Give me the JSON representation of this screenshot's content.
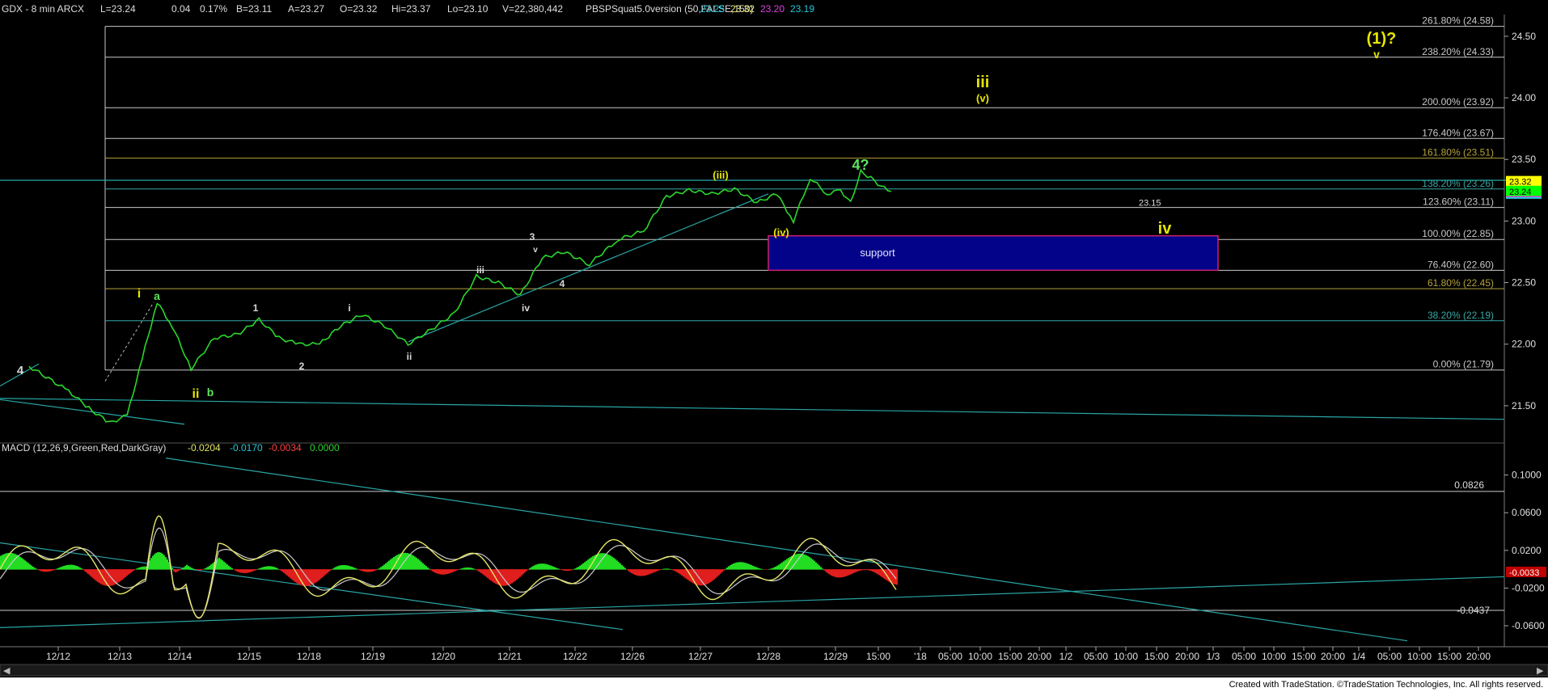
{
  "header": {
    "symbol": "GDX - 8 min  ARCX",
    "last": "L=23.24",
    "change": "0.04",
    "change_pct": "0.17%",
    "bid": "B=23.11",
    "ask": "A=23.27",
    "open": "O=23.32",
    "high": "Hi=23.37",
    "low": "Lo=23.10",
    "volume": "V=22,380,442",
    "indicator": "PBSPSquat5.0version (50,FALSE,150)",
    "ind_values": [
      "23.25",
      "23.32",
      "23.20",
      "23.19"
    ]
  },
  "colors": {
    "background": "#000000",
    "price": "#2bd62b",
    "fib_line": "#c8c8c8",
    "fib_gold": "#b5a23a",
    "fib_teal": "#3aa6a6",
    "trendline": "#2aa6a6",
    "wave_yellow": "#e6e600",
    "wave_green": "#5ee35e",
    "wave_white": "#d8d8d8",
    "support_fill": "#03038a",
    "support_border": "#d0206c",
    "macd_line": "#e6e66a",
    "macd_hist_pos": "#22dd22",
    "macd_hist_neg": "#e01e1e",
    "ind_cyan": "#22c9d9",
    "ind_yellow": "#e6e666",
    "ind_magenta": "#e040e0",
    "ind_cyan2": "#22c9d9"
  },
  "chart_data": [
    {
      "type": "line",
      "ylim": [
        21.25,
        24.65
      ],
      "yticks": [
        "24.50",
        "24.00",
        "23.50",
        "23.00",
        "22.50",
        "22.00",
        "21.50"
      ],
      "x_dates": [
        "12/12",
        "12/13",
        "12/14",
        "12/15",
        "12/18",
        "12/19",
        "12/20",
        "12/21",
        "12/22",
        "12/26",
        "12/27",
        "12/28",
        "12/29",
        "15:00",
        "'18",
        "05:00",
        "10:00",
        "15:00",
        "20:00",
        "1/2",
        "05:00",
        "10:00",
        "15:00",
        "20:00",
        "1/3",
        "05:00",
        "10:00",
        "15:00",
        "20:00",
        "1/4",
        "05:00",
        "10:00",
        "15:00",
        "20:00"
      ],
      "series": [
        {
          "x": [
            "12/11",
            "12/12",
            "12/12",
            "12/12",
            "12/13",
            "12/13",
            "12/13",
            "12/13",
            "12/14",
            "12/14",
            "12/14",
            "12/15",
            "12/15",
            "12/15",
            "12/18",
            "12/18",
            "12/18",
            "12/19",
            "12/19",
            "12/19",
            "12/20",
            "12/20",
            "12/20",
            "12/21",
            "12/21",
            "12/21",
            "12/22",
            "12/22",
            "12/26",
            "12/26",
            "12/26",
            "12/27",
            "12/27",
            "12/27",
            "12/28",
            "12/28",
            "12/28",
            "12/28",
            "12/29",
            "12/29",
            "12/29",
            "12/29",
            "12/29",
            "12/29"
          ],
          "values": [
            21.82,
            21.62,
            21.48,
            21.36,
            21.42,
            21.88,
            22.34,
            22.15,
            21.8,
            22.05,
            22.08,
            22.2,
            22.05,
            22.0,
            22.0,
            22.15,
            22.24,
            22.15,
            22.0,
            22.12,
            22.25,
            22.55,
            22.5,
            22.4,
            22.7,
            22.75,
            22.65,
            22.85,
            22.92,
            23.2,
            23.25,
            23.22,
            23.26,
            23.15,
            23.22,
            23.0,
            23.35,
            23.22,
            23.25,
            23.15,
            23.4,
            23.35,
            23.28,
            23.24
          ]
        }
      ],
      "fib_levels": [
        {
          "label": "261.80% (24.58)",
          "value": 24.58
        },
        {
          "label": "238.20% (24.33)",
          "value": 24.33
        },
        {
          "label": "200.00% (23.92)",
          "value": 23.92
        },
        {
          "label": "176.40% (23.67)",
          "value": 23.67
        },
        {
          "label": "161.80% (23.51)",
          "value": 23.51
        },
        {
          "label": "138.20% (23.26)",
          "value": 23.26
        },
        {
          "label": "123.60% (23.11)",
          "value": 23.11
        },
        {
          "label": "100.00% (22.85)",
          "value": 22.85
        },
        {
          "label": "76.40% (22.60)",
          "value": 22.6
        },
        {
          "label": "61.80% (22.45)",
          "value": 22.45
        },
        {
          "label": "38.20% (22.19)",
          "value": 22.19
        },
        {
          "label": "0.00% (21.79)",
          "value": 21.79
        }
      ],
      "axis_markers": [
        {
          "label": "23.32",
          "value": 23.32
        },
        {
          "label": "23.24",
          "value": 23.24
        },
        {
          "label": "23.15",
          "value": 23.15
        }
      ],
      "support_label": "support",
      "support_range": [
        22.6,
        22.88
      ],
      "wave_labels": [
        "4",
        "i",
        "a",
        "ii",
        "b",
        "1",
        "2",
        "i",
        "ii",
        "iii",
        "3",
        "v",
        "iv",
        "4",
        "(iii)",
        "(iv)",
        "4?",
        "iii",
        "(v)",
        "iv",
        "(1)?",
        "v"
      ]
    },
    {
      "type": "area",
      "title": "MACD (12,26,9,Green,Red,DarkGray)",
      "readouts": [
        "-0.0204",
        "-0.0170",
        "-0.0034",
        "0.0000"
      ],
      "ylim": [
        -0.078,
        0.128
      ],
      "yticks": [
        "0.1000",
        "0.0600",
        "0.0200",
        "-0.0200",
        "-0.0600"
      ],
      "level_labels": [
        "0.0826",
        "-0.0437"
      ],
      "last_value": "-0.0033"
    }
  ],
  "footer": {
    "text": "Created with TradeStation. ©TradeStation Technologies, Inc. All rights reserved."
  }
}
